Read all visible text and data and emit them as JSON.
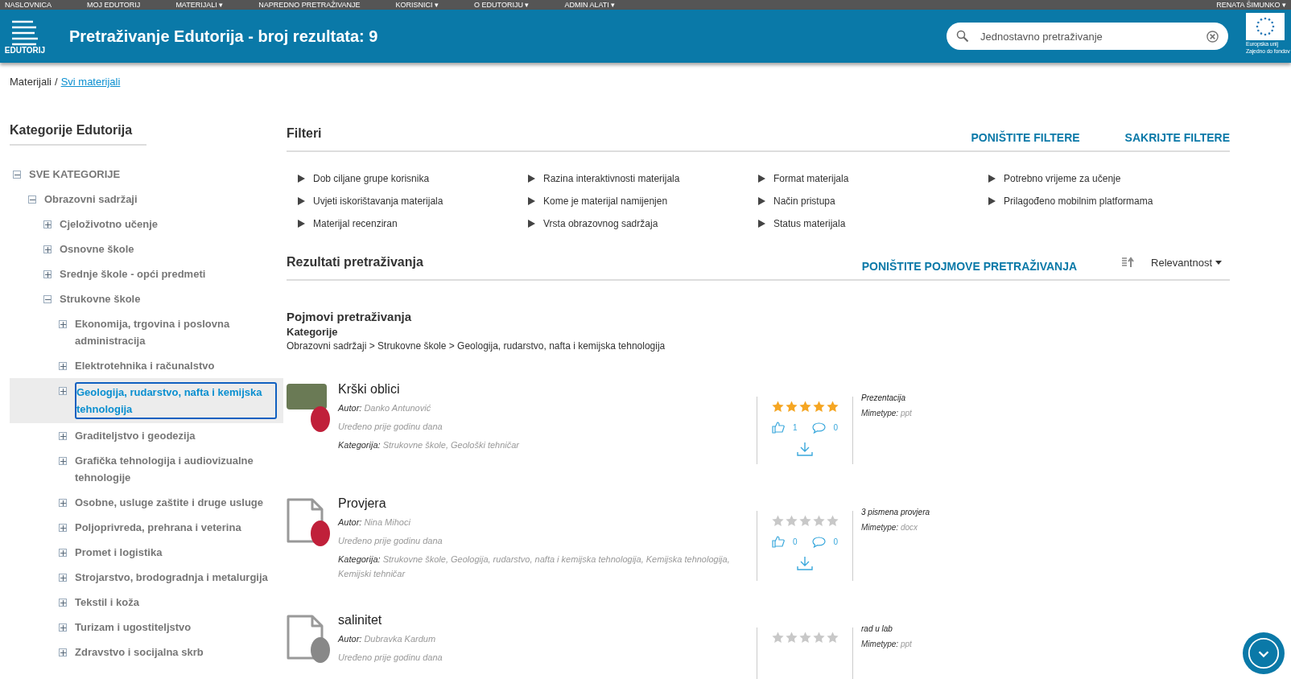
{
  "nav": {
    "items": [
      "NASLOVNICA",
      "MOJ EDUTORIJ",
      "MATERIJALI ▾",
      "NAPREDNO PRETRAŽIVANJE",
      "KORISNICI ▾",
      "O EDUTORIJU ▾",
      "ADMIN ALATI ▾"
    ],
    "user": "RENATA ŠIMUNKO ▾"
  },
  "banner": {
    "logo_text": "EDUTORIJ",
    "title": "Pretraživanje Edutorija - broj rezultata: 9",
    "search": {
      "placeholder": "Jednostavno pretraživanje"
    },
    "eu_lines": [
      "Europska unij",
      "Zajedno do fondov"
    ]
  },
  "breadcrumb": {
    "items": [
      "Materijali",
      "Svi materijali"
    ],
    "separator": "/"
  },
  "sidebar": {
    "title": "Kategorije Edutorija",
    "tree": [
      {
        "label": "SVE KATEGORIJE",
        "expanded": true,
        "selected": false,
        "children": [
          {
            "label": "Obrazovni sadržaji",
            "expanded": true,
            "selected": false,
            "children": [
              {
                "label": "Cjeloživotno učenje",
                "expanded": false,
                "selected": false
              },
              {
                "label": "Osnovne škole",
                "expanded": false,
                "selected": false
              },
              {
                "label": "Srednje škole - opći predmeti",
                "expanded": false,
                "selected": false
              },
              {
                "label": "Strukovne škole",
                "expanded": true,
                "selected": false,
                "children": [
                  {
                    "label": "Ekonomija, trgovina i poslovna administracija",
                    "expanded": false,
                    "selected": false
                  },
                  {
                    "label": "Elektrotehnika i računalstvo",
                    "expanded": false,
                    "selected": false
                  },
                  {
                    "label": "Geologija, rudarstvo, nafta i kemijska tehnologija",
                    "expanded": false,
                    "selected": true
                  },
                  {
                    "label": "Graditeljstvo i geodezija",
                    "expanded": false,
                    "selected": false
                  },
                  {
                    "label": "Grafička tehnologija i audiovizualne tehnologije",
                    "expanded": false,
                    "selected": false
                  },
                  {
                    "label": "Osobne, usluge zaštite i druge usluge",
                    "expanded": false,
                    "selected": false
                  },
                  {
                    "label": "Poljoprivreda, prehrana i veterina",
                    "expanded": false,
                    "selected": false
                  },
                  {
                    "label": "Promet i logistika",
                    "expanded": false,
                    "selected": false
                  },
                  {
                    "label": "Strojarstvo, brodogradnja i metalurgija",
                    "expanded": false,
                    "selected": false
                  },
                  {
                    "label": "Tekstil i koža",
                    "expanded": false,
                    "selected": false
                  },
                  {
                    "label": "Turizam i ugostiteljstvo",
                    "expanded": false,
                    "selected": false
                  },
                  {
                    "label": "Zdravstvo i socijalna skrb",
                    "expanded": false,
                    "selected": false
                  }
                ]
              }
            ]
          }
        ]
      }
    ]
  },
  "filters": {
    "title": "Filteri",
    "actions": [
      "PONIŠTITE FILTERE",
      "SAKRIJTE FILTERE"
    ],
    "items": [
      "Dob ciljane grupe korisnika",
      "Razina interaktivnosti materijala",
      "Format materijala",
      "Potrebno vrijeme za učenje",
      "Uvjeti iskorištavanja materijala",
      "Kome je materijal namijenjen",
      "Način pristupa",
      "Prilagođeno mobilnim platformama",
      "Materijal recenziran",
      "Vrsta obrazovnog sadržaja",
      "Status materijala"
    ]
  },
  "results": {
    "title": "Rezultati pretraživanja",
    "reset": "PONIŠTITE POJMOVE PRETRAŽIVANJA",
    "sort": "Relevantnost",
    "terms": {
      "title": "Pojmovi pretraživanja",
      "label": "Kategorije",
      "path": "Obrazovni sadržaji > Strukovne škole > Geologija, rudarstvo, nafta i kemijska tehnologija"
    },
    "items": [
      {
        "title": "Krški oblici",
        "thumbnail": {
          "kind": "photo"
        },
        "avatar": {
          "kind": "photo"
        },
        "author_label": "Autor:",
        "author": "Danko Antunović",
        "edited": "Uređeno prije godinu dana",
        "category_label": "Kategorija:",
        "category": "Strukovne škole, Geološki tehničar",
        "stars": 5,
        "likes": "1",
        "comments": "0",
        "type": "Prezentacija",
        "mime_label": "Mimetype:",
        "mime": "ppt"
      },
      {
        "title": "Provjera",
        "thumbnail": {
          "kind": "file"
        },
        "avatar": {
          "kind": "photo"
        },
        "author_label": "Autor:",
        "author": "Nina Mihoci",
        "edited": "Uređeno prije godinu dana",
        "category_label": "Kategorija:",
        "category": "Strukovne škole, Geologija, rudarstvo, nafta i kemijska tehnologija, Kemijska tehnologija, Kemijski tehničar",
        "stars": 0,
        "likes": "0",
        "comments": "0",
        "type": "3 pismena provjera",
        "mime_label": "Mimetype:",
        "mime": "docx"
      },
      {
        "title": "salinitet",
        "thumbnail": {
          "kind": "file"
        },
        "avatar": {
          "kind": "silhouette"
        },
        "author_label": "Autor:",
        "author": "Dubravka Kardum",
        "edited": "Uređeno prije godinu dana",
        "stars": 0,
        "type": "rad u lab",
        "mime_label": "Mimetype:",
        "mime": "ppt"
      }
    ]
  }
}
